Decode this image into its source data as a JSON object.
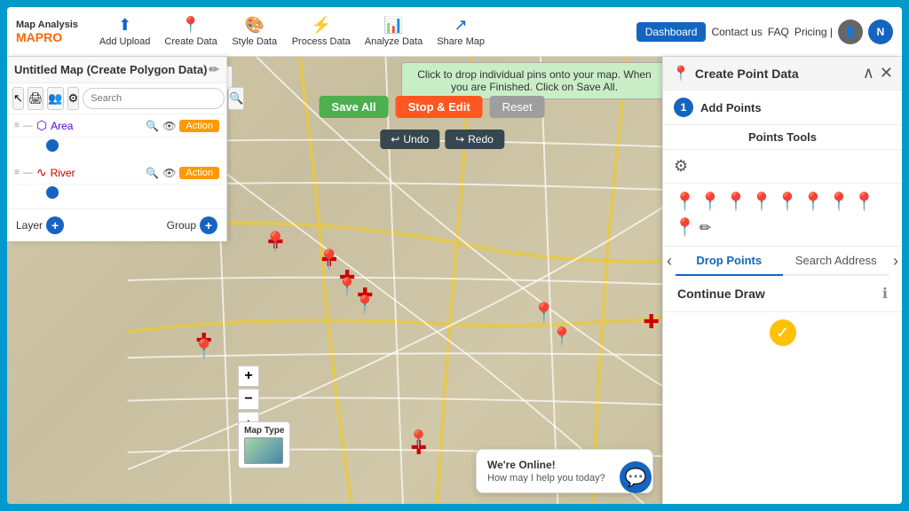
{
  "app": {
    "brand_top": "Map Analysis",
    "brand_bottom_map": "MAP",
    "brand_bottom_pro": "RO"
  },
  "nav": {
    "items": [
      {
        "id": "add-upload",
        "icon": "⬆",
        "label": "Add Upload"
      },
      {
        "id": "create-data",
        "icon": "📍",
        "label": "Create Data"
      },
      {
        "id": "style-data",
        "icon": "🎨",
        "label": "Style Data"
      },
      {
        "id": "process-data",
        "icon": "⚡",
        "label": "Process Data"
      },
      {
        "id": "analyze-data",
        "icon": "📊",
        "label": "Analyze Data"
      },
      {
        "id": "share-map",
        "icon": "↗",
        "label": "Share Map"
      }
    ],
    "dashboard": "Dashboard",
    "contact": "Contact us",
    "faq": "FAQ",
    "pricing": "Pricing |"
  },
  "left_panel": {
    "title": "Untitled Map (Create Polygon Data)",
    "layers": [
      {
        "id": "area",
        "name": "Area",
        "color": "#5500cc",
        "dot_color": "#1565c0",
        "type": "polygon"
      },
      {
        "id": "river",
        "name": "River",
        "color": "#cc0000",
        "dot_color": "#1565c0",
        "type": "river"
      }
    ],
    "layer_label": "Layer",
    "group_label": "Group"
  },
  "map": {
    "toast": "Click to drop individual pins onto your map. When you are Finished. Click on Save All.",
    "save_all": "Save All",
    "stop_edit": "Stop & Edit",
    "reset": "Reset",
    "undo": "Undo",
    "redo": "Redo",
    "search_placeholder": "Search",
    "zoom_in": "+",
    "zoom_out": "−",
    "map_type_label": "Map Type"
  },
  "right_panel": {
    "title": "Create Point Data",
    "step1": "1",
    "step1_label": "Add Points",
    "tools_header": "Points Tools",
    "tab_drop": "Drop Points",
    "tab_search": "Search Address",
    "continue_draw": "Continue Draw",
    "pin_colors": [
      "🔴",
      "🟠",
      "🔵",
      "🟣",
      "🟤",
      "💙",
      "🩷",
      "🟡",
      "🔶"
    ],
    "nav_left": "‹",
    "nav_right": "›"
  },
  "chat": {
    "online": "We're Online!",
    "help": "How may I help you today?"
  }
}
